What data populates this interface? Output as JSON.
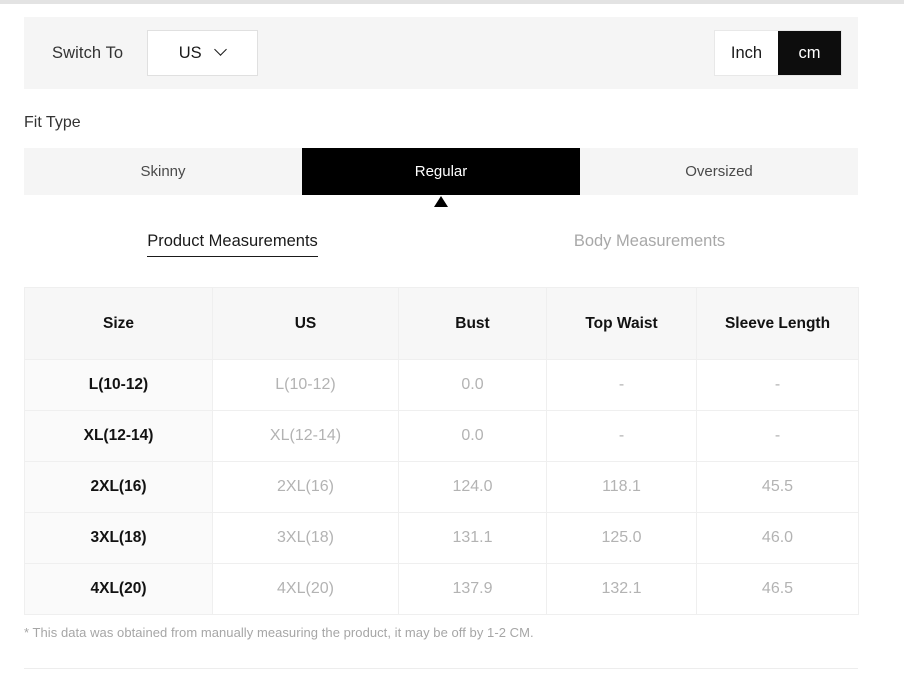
{
  "switch_bar": {
    "label": "Switch To",
    "region_select": {
      "value": "US",
      "icon": "chevron-down-icon"
    },
    "unit_toggle": {
      "options": [
        {
          "label": "Inch",
          "active": false
        },
        {
          "label": "cm",
          "active": true
        }
      ]
    }
  },
  "fit_type": {
    "title": "Fit Type",
    "options": [
      {
        "label": "Skinny",
        "active": false
      },
      {
        "label": "Regular",
        "active": true
      },
      {
        "label": "Oversized",
        "active": false
      }
    ]
  },
  "measurement_tabs": [
    {
      "label": "Product Measurements",
      "active": true
    },
    {
      "label": "Body Measurements",
      "active": false
    }
  ],
  "table": {
    "headers": [
      "Size",
      "US",
      "Bust",
      "Top Waist",
      "Sleeve Length"
    ],
    "rows": [
      {
        "size": "L(10-12)",
        "us": "L(10-12)",
        "bust": "0.0",
        "top_waist": "-",
        "sleeve_length": "-"
      },
      {
        "size": "XL(12-14)",
        "us": "XL(12-14)",
        "bust": "0.0",
        "top_waist": "-",
        "sleeve_length": "-"
      },
      {
        "size": "2XL(16)",
        "us": "2XL(16)",
        "bust": "124.0",
        "top_waist": "118.1",
        "sleeve_length": "45.5"
      },
      {
        "size": "3XL(18)",
        "us": "3XL(18)",
        "bust": "131.1",
        "top_waist": "125.0",
        "sleeve_length": "46.0"
      },
      {
        "size": "4XL(20)",
        "us": "4XL(20)",
        "bust": "137.9",
        "top_waist": "132.1",
        "sleeve_length": "46.5"
      }
    ]
  },
  "footnote": "* This data was obtained from manually measuring the product, it may be off by 1-2 CM.",
  "colors": {
    "active_background": "#000000",
    "active_text": "#ffffff",
    "panel_background": "#f5f5f5",
    "header_background": "#f7f7f7",
    "muted_text": "#b3b3b3"
  }
}
